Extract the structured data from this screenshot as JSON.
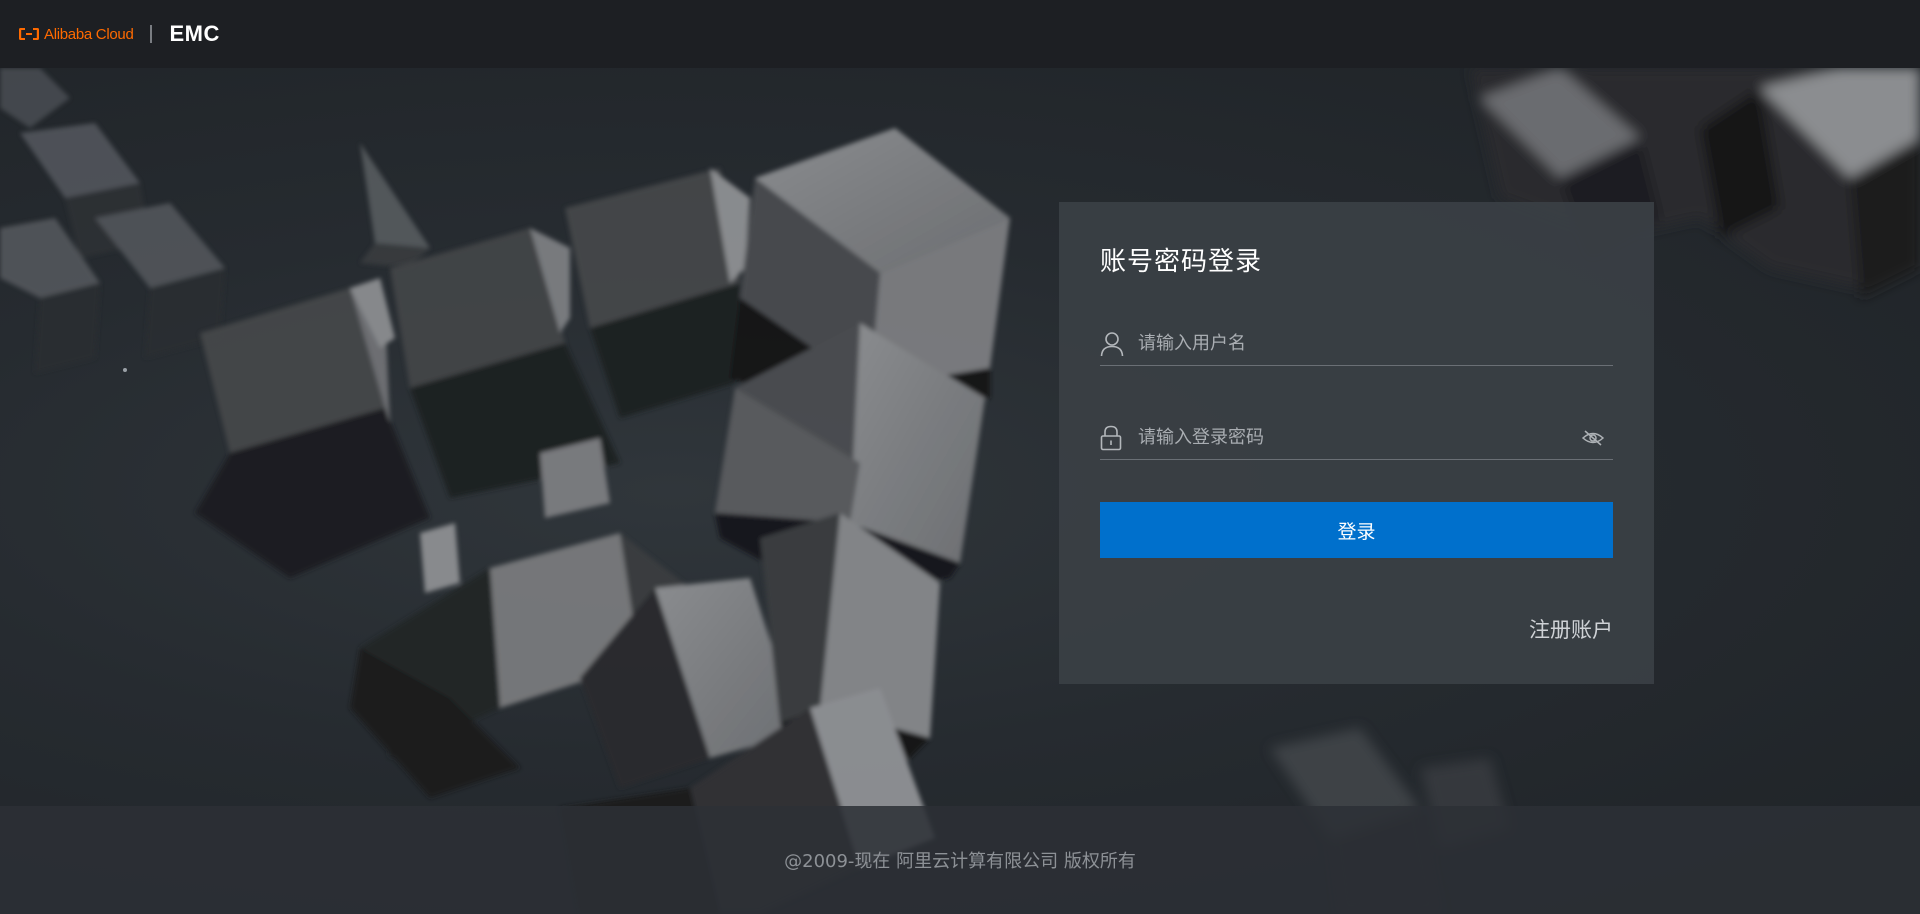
{
  "header": {
    "brand_text": "Alibaba Cloud",
    "product_name": "EMC",
    "brand_color": "#ff6a00"
  },
  "login": {
    "title": "账号密码登录",
    "username": {
      "placeholder": "请输入用户名",
      "value": "",
      "icon": "user-icon"
    },
    "password": {
      "placeholder": "请输入登录密码",
      "value": "",
      "icon": "lock-icon",
      "toggle_icon": "eye-off-icon"
    },
    "submit_label": "登录",
    "register_label": "注册账户",
    "accent_color": "#0070cc"
  },
  "footer": {
    "copyright": "@2009-现在 阿里云计算有限公司 版权所有"
  }
}
